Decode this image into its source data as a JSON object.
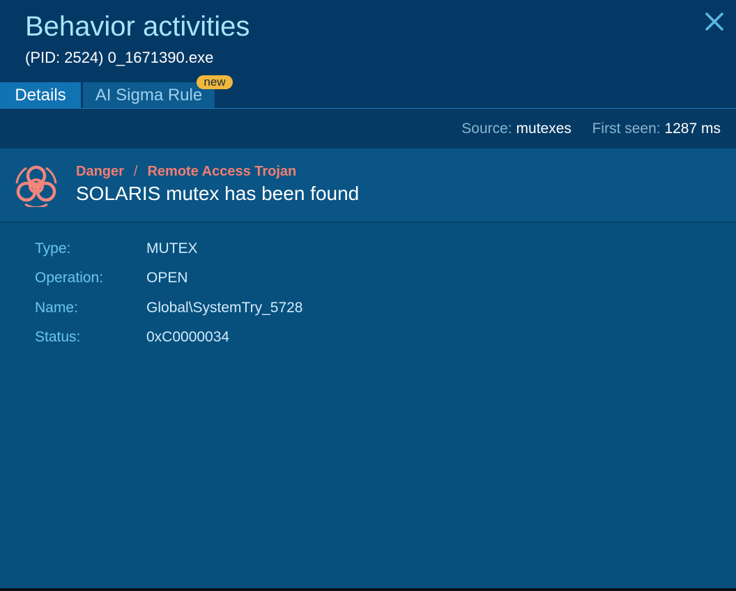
{
  "header": {
    "title": "Behavior activities",
    "subtitle": "(PID: 2524) 0_1671390.exe"
  },
  "tabs": [
    {
      "label": "Details",
      "active": true
    },
    {
      "label": "AI Sigma Rule",
      "active": false,
      "badge": "new"
    }
  ],
  "meta": {
    "source_label": "Source:",
    "source_value": "mutexes",
    "first_seen_label": "First seen:",
    "first_seen_value": "1287 ms"
  },
  "alert": {
    "icon": "biohazard-icon",
    "severity": "Danger",
    "separator": "/",
    "category": "Remote Access Trojan",
    "title": "SOLARIS mutex has been found"
  },
  "details": [
    {
      "key": "Type:",
      "value": "MUTEX"
    },
    {
      "key": "Operation:",
      "value": "OPEN"
    },
    {
      "key": "Name:",
      "value": "Global\\SystemTry_5728"
    },
    {
      "key": "Status:",
      "value": "0xC0000034"
    }
  ],
  "colors": {
    "background": "#07507d",
    "header": "#053965",
    "title": "#a6e6f8",
    "danger": "#f27d72",
    "badge": "#f0b83c",
    "label": "#6cc6ec"
  }
}
